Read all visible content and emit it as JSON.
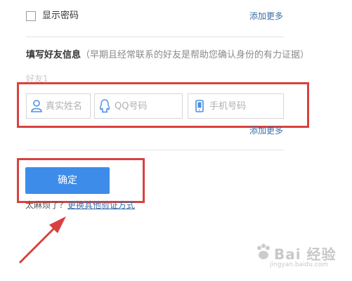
{
  "show_password": {
    "label": "显示密码",
    "checked": false
  },
  "add_more_top": "添加更多",
  "friend_section": {
    "title": "填写好友信息",
    "hint": "（早期且经常联系的好友是帮助您确认身份的有力证据）",
    "friend_label": "好友1",
    "inputs": {
      "name_placeholder": "真实姓名",
      "qq_placeholder": "QQ号码",
      "phone_placeholder": "手机号码"
    },
    "add_more": "添加更多"
  },
  "confirm_label": "确定",
  "trouble": {
    "question": "太麻烦了？",
    "link": "更换其他验证方式"
  },
  "watermark": {
    "main": "Bai 经验",
    "sub": "jingyan.baidu.com"
  },
  "colors": {
    "accent": "#3d8cea",
    "link": "#3b6ea8",
    "highlight": "#d9413f"
  }
}
